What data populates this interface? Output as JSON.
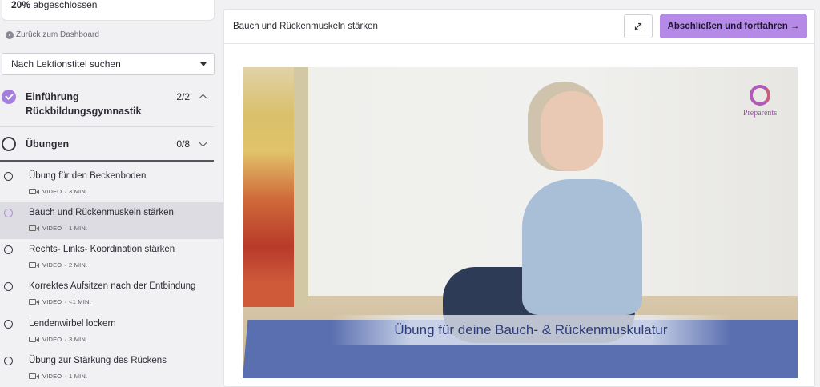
{
  "sidebar": {
    "progress": {
      "percent_label": "20%",
      "text": "abgeschlossen",
      "value": 0.2
    },
    "back_link": "Zurück zum Dashboard",
    "search": {
      "placeholder": "Nach Lektionstitel suchen"
    },
    "chapters": [
      {
        "title_line1": "Einführung",
        "title_line2": "Rückbildungsgymnastik",
        "count": "2/2",
        "status": "complete",
        "expanded": false
      },
      {
        "title": "Übungen",
        "count": "0/8",
        "status": "open",
        "expanded": true
      }
    ],
    "lessons": [
      {
        "title": "Übung für den Beckenboden",
        "type": "VIDEO",
        "sep": "·",
        "duration": "3 MIN."
      },
      {
        "title": "Bauch und Rückenmuskeln stärken",
        "type": "VIDEO",
        "sep": "·",
        "duration": "1 MIN.",
        "active": true
      },
      {
        "title": "Rechts- Links- Koordination stärken",
        "type": "VIDEO",
        "sep": "·",
        "duration": "2 MIN."
      },
      {
        "title": "Korrektes Aufsitzen nach der Entbindung",
        "type": "VIDEO",
        "sep": "·",
        "duration": "<1 MIN."
      },
      {
        "title": "Lendenwirbel lockern",
        "type": "VIDEO",
        "sep": "·",
        "duration": "3 MIN."
      },
      {
        "title": "Übung zur Stärkung des Rückens",
        "type": "VIDEO",
        "sep": "·",
        "duration": "1 MIN."
      }
    ]
  },
  "main": {
    "lesson_title": "Bauch und Rückenmuskeln stärken",
    "continue_label": "Abschließen und fortfahren →",
    "video": {
      "caption": "Übung für deine Bauch- & Rückenmuskulatur",
      "logo_text": "Preparents"
    }
  },
  "colors": {
    "accent": "#b48ae6",
    "active_row": "#dcdce2"
  }
}
